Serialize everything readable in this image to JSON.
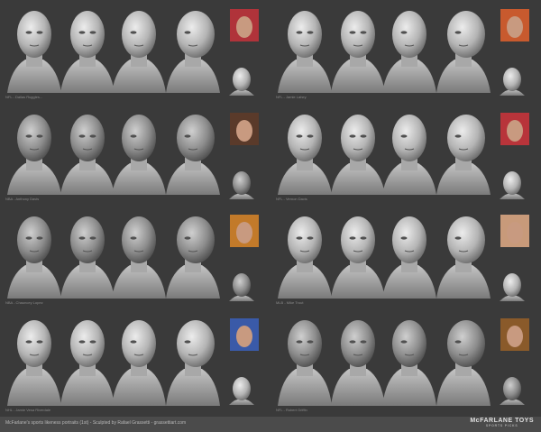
{
  "panels": [
    {
      "label": "NFL - Dallas Ruggles...",
      "photo_color": "#b0333a"
    },
    {
      "label": "NFL - Jamie Lahey",
      "photo_color": "#c85a2e"
    },
    {
      "label": "NBA - Anthony Davis",
      "photo_color": "#5a3a2a"
    },
    {
      "label": "NFL - Vernon Davis",
      "photo_color": "#b8343a"
    },
    {
      "label": "NBA - Chauncey Lopez",
      "photo_color": "#c27a2a"
    },
    {
      "label": "MLB - Mike Trout",
      "photo_color": "#c89a7a"
    },
    {
      "label": "NHL - Jamie Vesa Riverdale",
      "photo_color": "#3a5aa8"
    },
    {
      "label": "NFL - Robert Griffin",
      "photo_color": "#8a5a2a"
    }
  ],
  "footer": {
    "caption": "McFarlane's sports likeness portraits (1st) - Sculpted by Rafael Grassetti - grassettiart.com"
  },
  "brand": {
    "name": "McFARLANE TOYS",
    "tagline": "SPORTS PICKS"
  },
  "colors": {
    "background": "#3a3a3a",
    "sculpt_light": "#d6d6d6",
    "sculpt_dark": "#5e5e5e"
  }
}
